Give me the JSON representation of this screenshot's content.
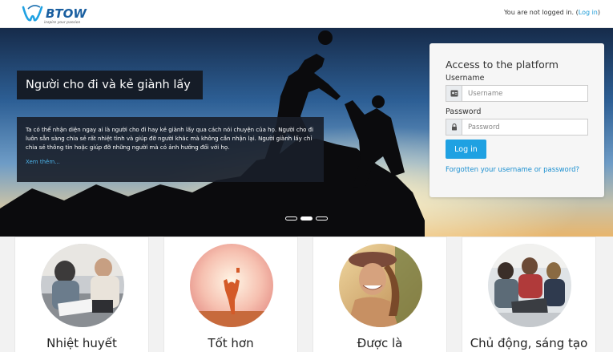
{
  "header": {
    "logo_text": "BTOW",
    "logo_tagline": "inspire your passion",
    "status_prefix": "You are not logged in. (",
    "login_link": "Log in",
    "status_suffix": ")"
  },
  "hero": {
    "title": "Người cho đi và kẻ giành lấy",
    "text": "Ta có thể nhận diện ngay ai là người cho đi hay kẻ giành lấy qua cách nói chuyện của họ. Người cho đi luôn sẵn sàng chia sẻ rất nhiệt tình và giúp đỡ người khác mà không cần nhận lại. Người giành lấy chỉ chia sẻ thông tin hoặc giúp đỡ những người mà có ảnh hưởng đối với họ.",
    "more_link": "Xem thêm...",
    "slides": 3,
    "active_slide": 2
  },
  "login": {
    "heading": "Access to the platform",
    "username_label": "Username",
    "username_placeholder": "Username",
    "username_value": "",
    "password_label": "Password",
    "password_placeholder": "Password",
    "password_value": "",
    "submit_label": "Log in",
    "forgot_link": "Forgotten your username or password?"
  },
  "cards": [
    {
      "title": "Nhiệt huyết",
      "image": "team-meeting-photo"
    },
    {
      "title": "Tốt hơn",
      "image": "sunset-victory-photo"
    },
    {
      "title": "Được là",
      "image": "laughing-woman-photo"
    },
    {
      "title": "Chủ động, sáng tạo",
      "image": "team-laptop-photo"
    }
  ],
  "colors": {
    "accent": "#1fa1e2",
    "link": "#1a8fd0",
    "hero_panel": "#151c27"
  },
  "icons": {
    "username": "user-icon",
    "password": "lock-icon"
  }
}
